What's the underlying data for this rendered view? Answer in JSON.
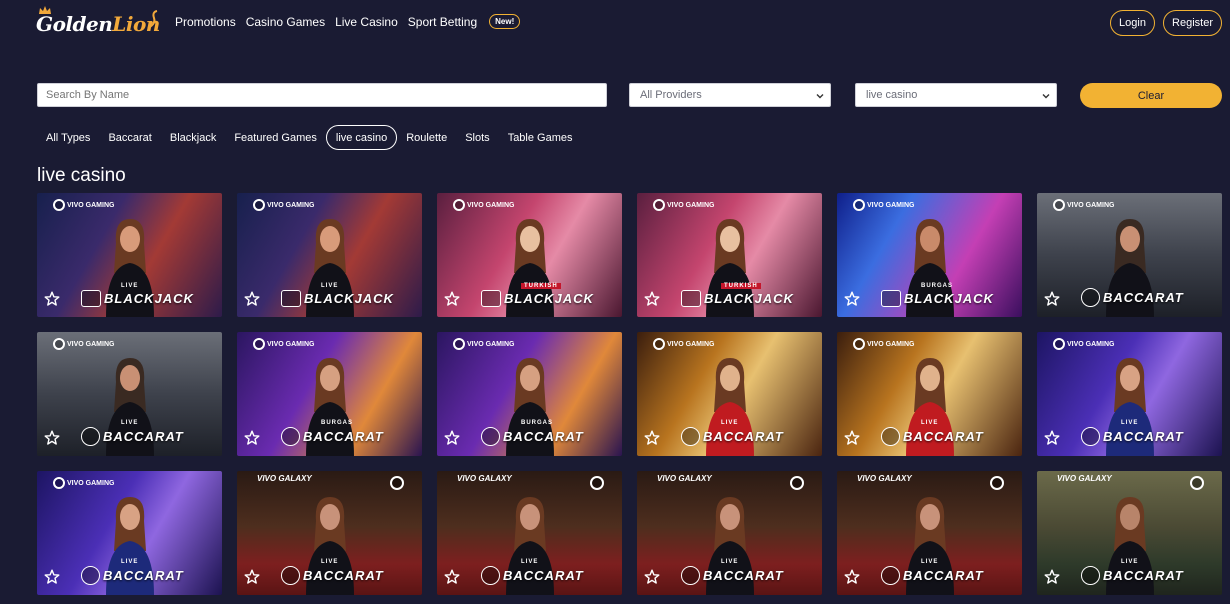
{
  "brand": {
    "name_part1": "Golden",
    "name_part2": "Lion"
  },
  "nav": {
    "items": [
      "Promotions",
      "Casino Games",
      "Live Casino",
      "Sport Betting"
    ],
    "badge": "New!"
  },
  "auth": {
    "login": "Login",
    "register": "Register"
  },
  "filters": {
    "search_placeholder": "Search By Name",
    "provider_value": "All Providers",
    "category_value": "live casino",
    "clear_label": "Clear"
  },
  "tabs": [
    "All Types",
    "Baccarat",
    "Blackjack",
    "Featured Games",
    "live casino",
    "Roulette",
    "Slots",
    "Table Games"
  ],
  "active_tab": "live casino",
  "section_title": "live casino",
  "colors": {
    "accent": "#f2b233",
    "background": "#1a1b33"
  },
  "games": [
    {
      "name": "BLACKJACK",
      "sub": "LIVE",
      "provider": "VIVO GAMING",
      "icon": "cards-icon",
      "theme": "blue-red"
    },
    {
      "name": "BLACKJACK",
      "sub": "LIVE",
      "provider": "VIVO GAMING",
      "icon": "cards-icon",
      "theme": "blue-red"
    },
    {
      "name": "BLACKJACK",
      "sub": "TURKISH",
      "provider": "VIVO GAMING",
      "icon": "cards-icon",
      "theme": "pink"
    },
    {
      "name": "BLACKJACK",
      "sub": "TURKISH",
      "provider": "VIVO GAMING",
      "icon": "cards-icon",
      "theme": "pink"
    },
    {
      "name": "BLACKJACK",
      "sub": "BURGAS",
      "provider": "VIVO GAMING",
      "icon": "cards-icon",
      "theme": "neon"
    },
    {
      "name": "BACCARAT",
      "sub": "",
      "provider": "VIVO GAMING",
      "icon": "chip-icon",
      "theme": "grey"
    },
    {
      "name": "BACCARAT",
      "sub": "LIVE",
      "provider": "VIVO GAMING",
      "icon": "chip-icon",
      "theme": "grey"
    },
    {
      "name": "BACCARAT",
      "sub": "BURGAS",
      "provider": "VIVO GAMING",
      "icon": "chip-icon",
      "theme": "purple"
    },
    {
      "name": "BACCARAT",
      "sub": "BURGAS",
      "provider": "VIVO GAMING",
      "icon": "chip-icon",
      "theme": "purple"
    },
    {
      "name": "BACCARAT",
      "sub": "LIVE",
      "provider": "VIVO GAMING",
      "icon": "chip-icon",
      "theme": "gold"
    },
    {
      "name": "BACCARAT",
      "sub": "LIVE",
      "provider": "VIVO GAMING",
      "icon": "chip-icon",
      "theme": "gold"
    },
    {
      "name": "BACCARAT",
      "sub": "LIVE",
      "provider": "VIVO GAMING",
      "icon": "chip-icon",
      "theme": "violet"
    },
    {
      "name": "BACCARAT",
      "sub": "LIVE",
      "provider": "VIVO GAMING",
      "icon": "chip-icon",
      "theme": "violet"
    },
    {
      "name": "BACCARAT",
      "sub": "LIVE",
      "provider": "VIVO GALAXY",
      "icon": "chip-icon",
      "theme": "table"
    },
    {
      "name": "BACCARAT",
      "sub": "LIVE",
      "provider": "VIVO GALAXY",
      "icon": "chip-icon",
      "theme": "table"
    },
    {
      "name": "BACCARAT",
      "sub": "LIVE",
      "provider": "VIVO GALAXY",
      "icon": "chip-icon",
      "theme": "table"
    },
    {
      "name": "BACCARAT",
      "sub": "LIVE",
      "provider": "VIVO GALAXY",
      "icon": "chip-icon",
      "theme": "table"
    },
    {
      "name": "BACCARAT",
      "sub": "LIVE",
      "provider": "VIVO GALAXY",
      "icon": "chip-icon",
      "theme": "olive"
    }
  ]
}
